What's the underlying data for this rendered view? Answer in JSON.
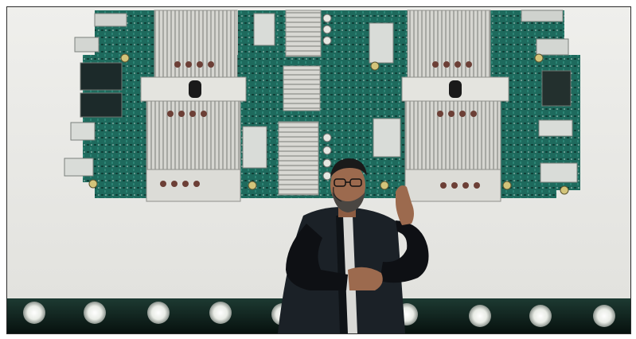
{
  "scene": {
    "subject": "speaker-on-stage",
    "screen_content": "server-circuit-board",
    "colors": {
      "screen_bg": "#ecebe7",
      "pcb_green": "#1f6b5f",
      "pcb_dark": "#124a40",
      "heatsink": "#d9d9d4",
      "stage_floor": "#0c1a16",
      "spotlight": "#f4f6f0",
      "jacket": "#1a1f24",
      "sleeve": "#0d0f12",
      "skin": "#9c6a4e"
    },
    "stage_lights_count": 10
  }
}
